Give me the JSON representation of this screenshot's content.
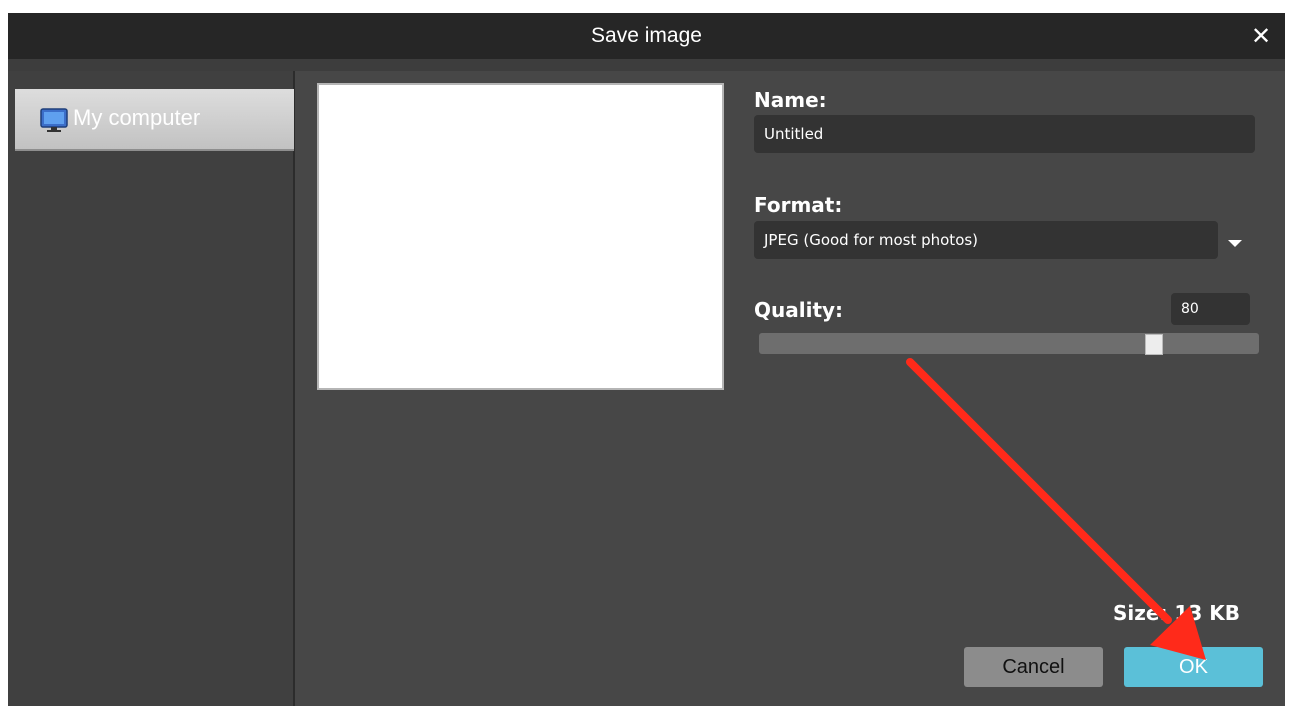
{
  "dialog": {
    "title": "Save image",
    "close_glyph": "✕"
  },
  "sidebar": {
    "items": [
      {
        "label": "My computer",
        "icon": "computer-icon",
        "selected": true
      }
    ]
  },
  "form": {
    "name_label": "Name:",
    "name_value": "Untitled",
    "format_label": "Format:",
    "format_value": "JPEG (Good for most photos)",
    "quality_label": "Quality:",
    "quality_value": "80",
    "quality_slider_fraction": 0.8,
    "size_text": "Size: 13 KB"
  },
  "buttons": {
    "cancel": "Cancel",
    "ok": "OK"
  },
  "colors": {
    "ok_button": "#5bc0d8",
    "annotation_arrow": "#ff2a1a"
  }
}
